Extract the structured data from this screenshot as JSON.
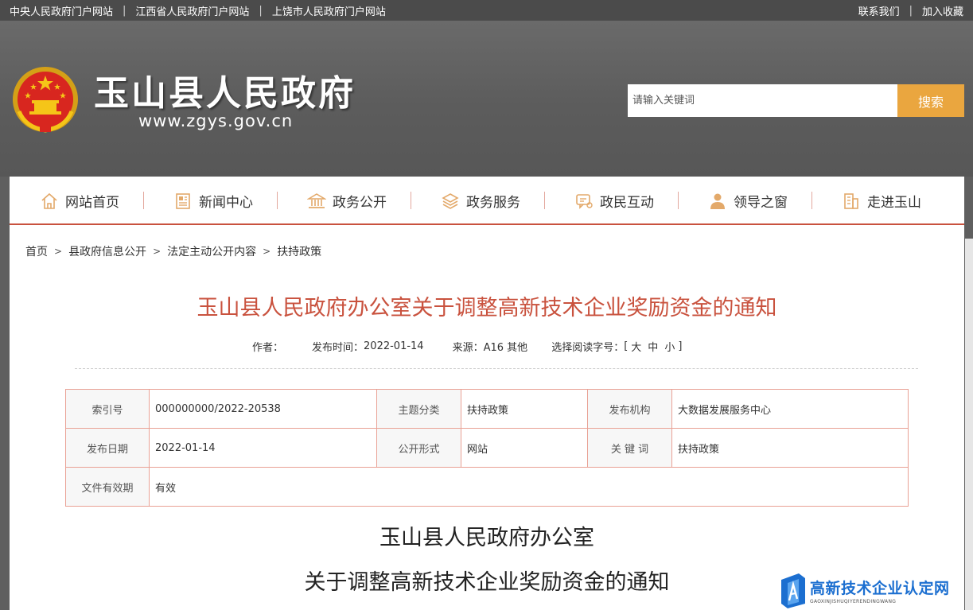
{
  "topbar": {
    "left_links": [
      "中央人民政府门户网站",
      "江西省人民政府门户网站",
      "上饶市人民政府门户网站"
    ],
    "right_links": [
      "联系我们",
      "加入收藏"
    ]
  },
  "header": {
    "site_name": "玉山县人民政府",
    "site_url": "www.zgys.gov.cn",
    "search_placeholder": "请输入关键词",
    "search_button": "搜索"
  },
  "nav": {
    "items": [
      {
        "label": "网站首页",
        "icon": "home-icon"
      },
      {
        "label": "新闻中心",
        "icon": "news-icon"
      },
      {
        "label": "政务公开",
        "icon": "government-building-icon"
      },
      {
        "label": "政务服务",
        "icon": "layers-icon"
      },
      {
        "label": "政民互动",
        "icon": "chat-icon"
      },
      {
        "label": "领导之窗",
        "icon": "person-icon"
      },
      {
        "label": "走进玉山",
        "icon": "buildings-icon"
      }
    ]
  },
  "breadcrumb": [
    "首页",
    "县政府信息公开",
    "法定主动公开内容",
    "扶持政策"
  ],
  "article": {
    "title": "玉山县人民政府办公室关于调整高新技术企业奖励资金的通知",
    "meta": {
      "author_label": "作者：",
      "date_label": "发布时间：",
      "date_value": "2022-01-14",
      "source_label": "来源：",
      "source_value": "A16 其他",
      "font_label": "选择阅读字号：",
      "bracket_open": "[",
      "bracket_close": "]",
      "sizes": [
        "大",
        "中",
        "小"
      ]
    },
    "info_table": {
      "row1": {
        "index_label": "索引号",
        "index_value": "000000000/2022-20538",
        "topic_label": "主题分类",
        "topic_value": "扶持政策",
        "org_label": "发布机构",
        "org_value": "大数据发展服务中心"
      },
      "row2": {
        "date_label": "发布日期",
        "date_value": "2022-01-14",
        "form_label": "公开形式",
        "form_value": "网站",
        "keyword_label": "关 键 词",
        "keyword_value": "扶持政策"
      },
      "row3": {
        "validity_label": "文件有效期",
        "validity_value": "有效"
      }
    },
    "doc_title_line1": "玉山县人民政府办公室",
    "doc_title_line2": "关于调整高新技术企业奖励资金的通知"
  },
  "watermark": {
    "text": "高新技术企业认定网",
    "sub": "GAOXINJISHUQIYERENDINGWANG"
  },
  "colors": {
    "accent_red": "#c9523e",
    "search_orange": "#eaa63f",
    "header_gray": "#5f5f5f",
    "watermark_blue": "#1c6fd0"
  }
}
